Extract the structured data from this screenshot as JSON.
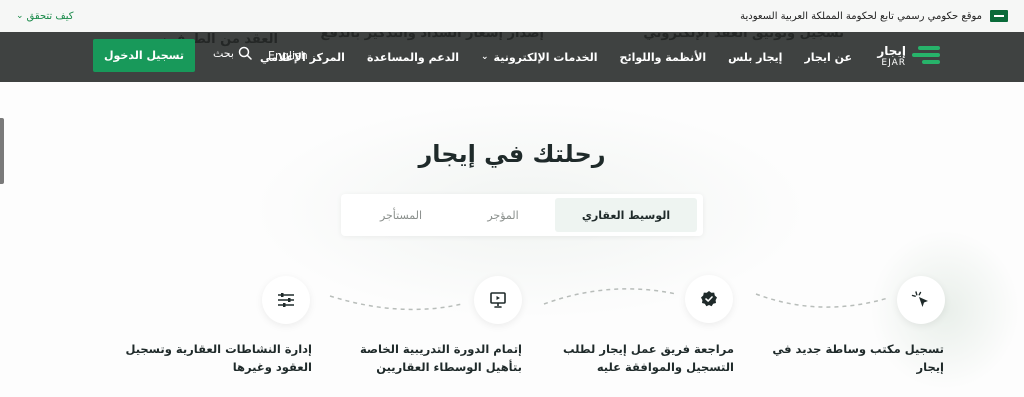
{
  "gov_bar": {
    "official_text": "موقع حكومي رسمي تابع لحكومة المملكة العربية السعودية",
    "verify_label": "كيف تتحقق"
  },
  "header_overlay": {
    "line_right": "تسجيل وتوثيق العقد الإلكتروني",
    "line_mid": "تسجيل وتوثيق العقد الإلكتروني",
    "line_mid2": "إصدار إشعار السداد والتذكير بالدفع",
    "line_left": "العقد من الطرفين"
  },
  "nav": {
    "logo_ar": "إيجار",
    "logo_en": "EJAR",
    "links": [
      {
        "label": "عن ايجار"
      },
      {
        "label": "إيجار بلس"
      },
      {
        "label": "الأنظمة واللوائح"
      },
      {
        "label": "الخدمات الإلكترونية"
      },
      {
        "label": "الدعم والمساعدة"
      },
      {
        "label": "المركز الإعلامي"
      }
    ],
    "language": "English",
    "search_label": "بحث",
    "login_label": "تسجيل الدخول"
  },
  "journey": {
    "title": "رحلتك في إيجار",
    "tabs": [
      {
        "label": "الوسيط العقاري",
        "active": true
      },
      {
        "label": "المؤجر",
        "active": false
      },
      {
        "label": "المستأجر",
        "active": false
      }
    ],
    "steps": [
      {
        "icon": "cursor-click-icon",
        "text": "تسجيل مكتب وساطة جديد في إيجار"
      },
      {
        "icon": "badge-check-icon",
        "text": "مراجعة فريق عمل إيجار لطلب التسجيل والموافقة عليه"
      },
      {
        "icon": "presentation-board-icon",
        "text": "إتمام الدورة التدريبية الخاصة بتأهيل الوسطاء العقاريين"
      },
      {
        "icon": "sliders-icon",
        "text": "إدارة النشاطات العقارية وتسجيل العقود وغيرها"
      }
    ]
  },
  "colors": {
    "brand_green": "#18995a",
    "header_bg": "#3f4241",
    "tab_active_bg": "#eef4f1"
  }
}
